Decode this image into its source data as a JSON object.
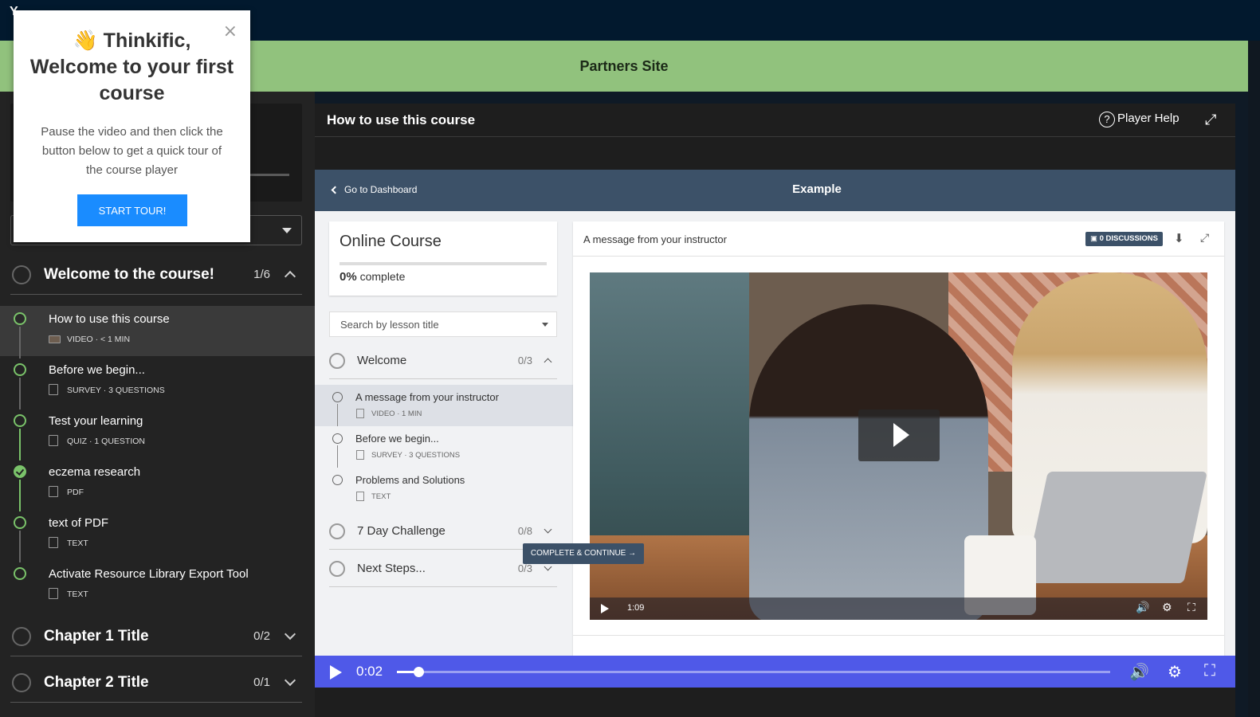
{
  "topbar": {
    "text": "Y"
  },
  "site": {
    "banner": "Partners Site"
  },
  "popup": {
    "title": "👋 Thinkific, Welcome to your first course",
    "body": "Pause the video and then click the button below to get a quick tour of the course player",
    "button": "START TOUR!",
    "close": "×"
  },
  "sidebar": {
    "chapters": [
      {
        "title": "Welcome to the course!",
        "count": "1/6",
        "expanded": true
      },
      {
        "title": "Chapter 1 Title",
        "count": "0/2",
        "expanded": false
      },
      {
        "title": "Chapter 2 Title",
        "count": "0/1",
        "expanded": false
      }
    ],
    "lessons": [
      {
        "name": "How to use this course",
        "meta": "VIDEO · < 1 MIN",
        "icon": "video-icon",
        "active": true
      },
      {
        "name": "Before we begin...",
        "meta": "SURVEY · 3 QUESTIONS",
        "icon": "survey-icon"
      },
      {
        "name": "Test your learning",
        "meta": "QUIZ · 1 QUESTION",
        "icon": "quiz-icon"
      },
      {
        "name": "eczema research",
        "meta": "PDF",
        "icon": "pdf-icon",
        "completed": true
      },
      {
        "name": "text of PDF",
        "meta": "TEXT",
        "icon": "text-icon"
      },
      {
        "name": "Activate Resource Library Export Tool",
        "meta": "TEXT",
        "icon": "text-icon"
      }
    ]
  },
  "player": {
    "title": "How to use this course",
    "help": "Player Help",
    "help_icon": "?",
    "time": "0:02",
    "progress": 0.03
  },
  "embed": {
    "back": "Go to Dashboard",
    "title": "Example",
    "course_title": "Online Course",
    "percent": "0%",
    "complete_label": "complete",
    "search_placeholder": "Search by lesson title",
    "chapters": [
      {
        "title": "Welcome",
        "count": "0/3"
      },
      {
        "title": "7 Day Challenge",
        "count": "0/8"
      },
      {
        "title": "Next Steps...",
        "count": "0/3"
      }
    ],
    "lessons": [
      {
        "name": "A message from your instructor",
        "meta": "VIDEO · 1 MIN"
      },
      {
        "name": "Before we begin...",
        "meta": "SURVEY · 3 QUESTIONS"
      },
      {
        "name": "Problems and Solutions",
        "meta": "TEXT"
      }
    ],
    "lesson_title": "A message from your instructor",
    "discussions": "0 DISCUSSIONS",
    "video_time": "1:09",
    "complete_button": "COMPLETE & CONTINUE →"
  },
  "colors": {
    "accent": "#4f59e8",
    "banner": "#91c27d",
    "progress_green": "#7ac36a",
    "nav_blue": "#3c5168"
  }
}
